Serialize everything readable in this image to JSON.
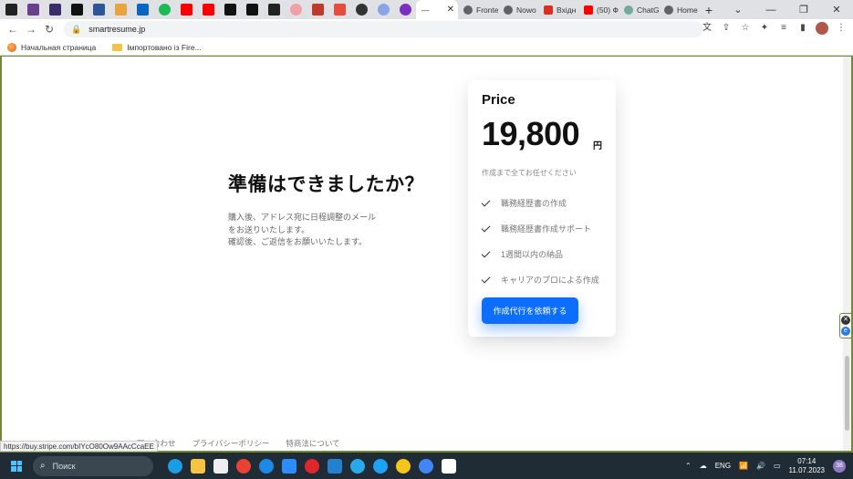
{
  "browser": {
    "tabs": [
      {
        "label": "Fronte",
        "color": "#5f6368"
      },
      {
        "label": "Nowo",
        "color": "#5f6368"
      },
      {
        "label": "Вхідн",
        "color": "#d93025"
      },
      {
        "label": "(50) Ф",
        "color": "#ff0000"
      },
      {
        "label": "ChatG",
        "color": "#74aa9c"
      },
      {
        "label": "Home",
        "color": "#5f6368"
      }
    ],
    "active_tab": {
      "label": "—",
      "icon": "minus-icon"
    },
    "url": "smartresume.jp"
  },
  "bookmarks": {
    "items": [
      {
        "label": "Начальная страница",
        "icon": "firefox-icon"
      },
      {
        "label": "Імпортовано із Fire...",
        "icon": "folder-icon"
      }
    ]
  },
  "page": {
    "cta": {
      "title": "準備はできましたか？",
      "desc_lines": [
        "購入後、アドレス宛に日程調整のメール",
        "をお送りいたします。",
        "確認後、ご返信をお願いいたします。"
      ]
    },
    "card": {
      "title": "Price",
      "price": "19,800",
      "unit": "円",
      "subtitle": "作成まで全てお任せください",
      "features": [
        "職務経歴書の作成",
        "職務経歴書作成サポート",
        "1週間以内の納品",
        "キャリアのプロによる作成"
      ],
      "button": "作成代行を依頼する"
    },
    "footer": {
      "links": [
        "問い合わせ",
        "プライバシーポリシー",
        "特商法について"
      ]
    }
  },
  "status_url": "https://buy.stripe.com/bIYcO80Ow9AAcCcaEE",
  "taskbar": {
    "search_placeholder": "Поиск",
    "lang": "ENG",
    "time": "07:14",
    "date": "11.07.2023",
    "notifications": "38"
  },
  "colors": {
    "accent": "#0d6efd",
    "frame": "#6f8b3a",
    "taskbar": "#1f2c35"
  }
}
